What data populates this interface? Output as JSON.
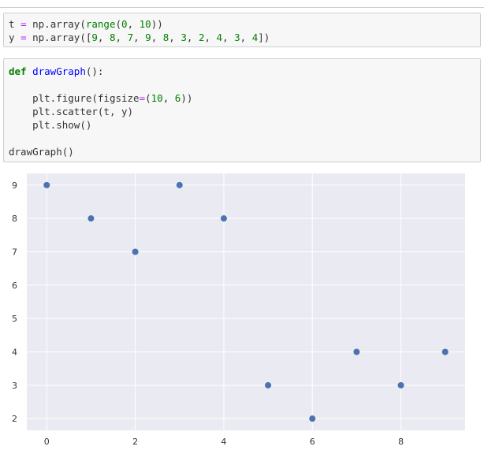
{
  "cell_input_1": {
    "line_t": {
      "var": "t",
      "op": "=",
      "call": "np.array(",
      "builtin": "range",
      "open": "(",
      "a": "0",
      "sep": ",",
      "b": "10",
      "close": "))"
    },
    "line_y": {
      "var": "y",
      "op": "=",
      "call": "np.array([",
      "vals": [
        "9",
        "8",
        "7",
        "9",
        "8",
        "3",
        "2",
        "4",
        "3",
        "4"
      ],
      "close": "])"
    }
  },
  "cell_input_2": {
    "kw_def": "def",
    "func_name": "drawGraph",
    "def_tail": "():",
    "line_figure": {
      "call": "plt.figure(",
      "param": "figsize",
      "eq": "=",
      "open": "(",
      "a": "10",
      "sep": ",",
      "b": "6",
      "close": "))"
    },
    "line_scatter": "plt.scatter(t, y)",
    "line_show": "plt.show()",
    "line_call": "drawGraph()"
  },
  "chart_data": {
    "type": "scatter",
    "x": [
      0,
      1,
      2,
      3,
      4,
      5,
      6,
      7,
      8,
      9
    ],
    "y": [
      9,
      8,
      7,
      9,
      8,
      3,
      2,
      4,
      3,
      4
    ],
    "xticks": [
      0,
      2,
      4,
      6,
      8
    ],
    "yticks": [
      2,
      3,
      4,
      5,
      6,
      7,
      8,
      9
    ],
    "xlim": [
      -0.45,
      9.45
    ],
    "ylim": [
      1.65,
      9.35
    ],
    "grid": true,
    "colors": {
      "marker": "#4c72b0",
      "background": "#eaeaf2",
      "grid": "#ffffff",
      "tick_label": "#333333"
    }
  }
}
